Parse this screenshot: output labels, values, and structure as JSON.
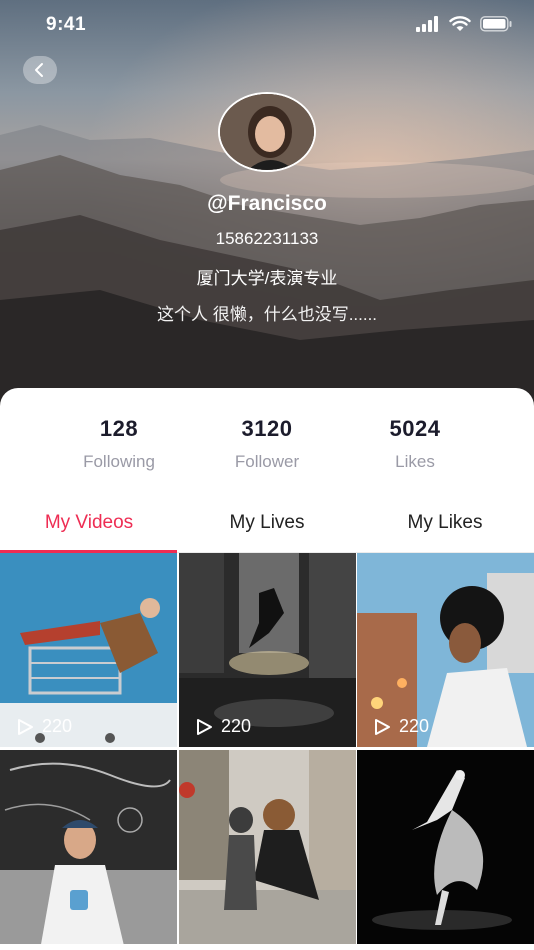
{
  "status_bar": {
    "time": "9:41",
    "icons": [
      "signal-icon",
      "wifi-icon",
      "battery-icon"
    ]
  },
  "profile": {
    "username": "@Francisco",
    "phone": "15862231133",
    "school": "厦门大学/表演专业",
    "bio": "这个人 很懒，什么也没写......"
  },
  "stats": [
    {
      "value": "128",
      "label": "Following"
    },
    {
      "value": "3120",
      "label": "Follower"
    },
    {
      "value": "5024",
      "label": "Likes"
    }
  ],
  "tabs": [
    {
      "label": "My Videos",
      "active": true
    },
    {
      "label": "My Lives",
      "active": false
    },
    {
      "label": "My Likes",
      "active": false
    }
  ],
  "videos": [
    {
      "views": "220"
    },
    {
      "views": "220"
    },
    {
      "views": "220"
    },
    {
      "views": ""
    },
    {
      "views": ""
    },
    {
      "views": ""
    }
  ],
  "colors": {
    "accent": "#ee2d53",
    "stat_value": "#1c1c2c",
    "stat_label": "#9a9aa6"
  }
}
